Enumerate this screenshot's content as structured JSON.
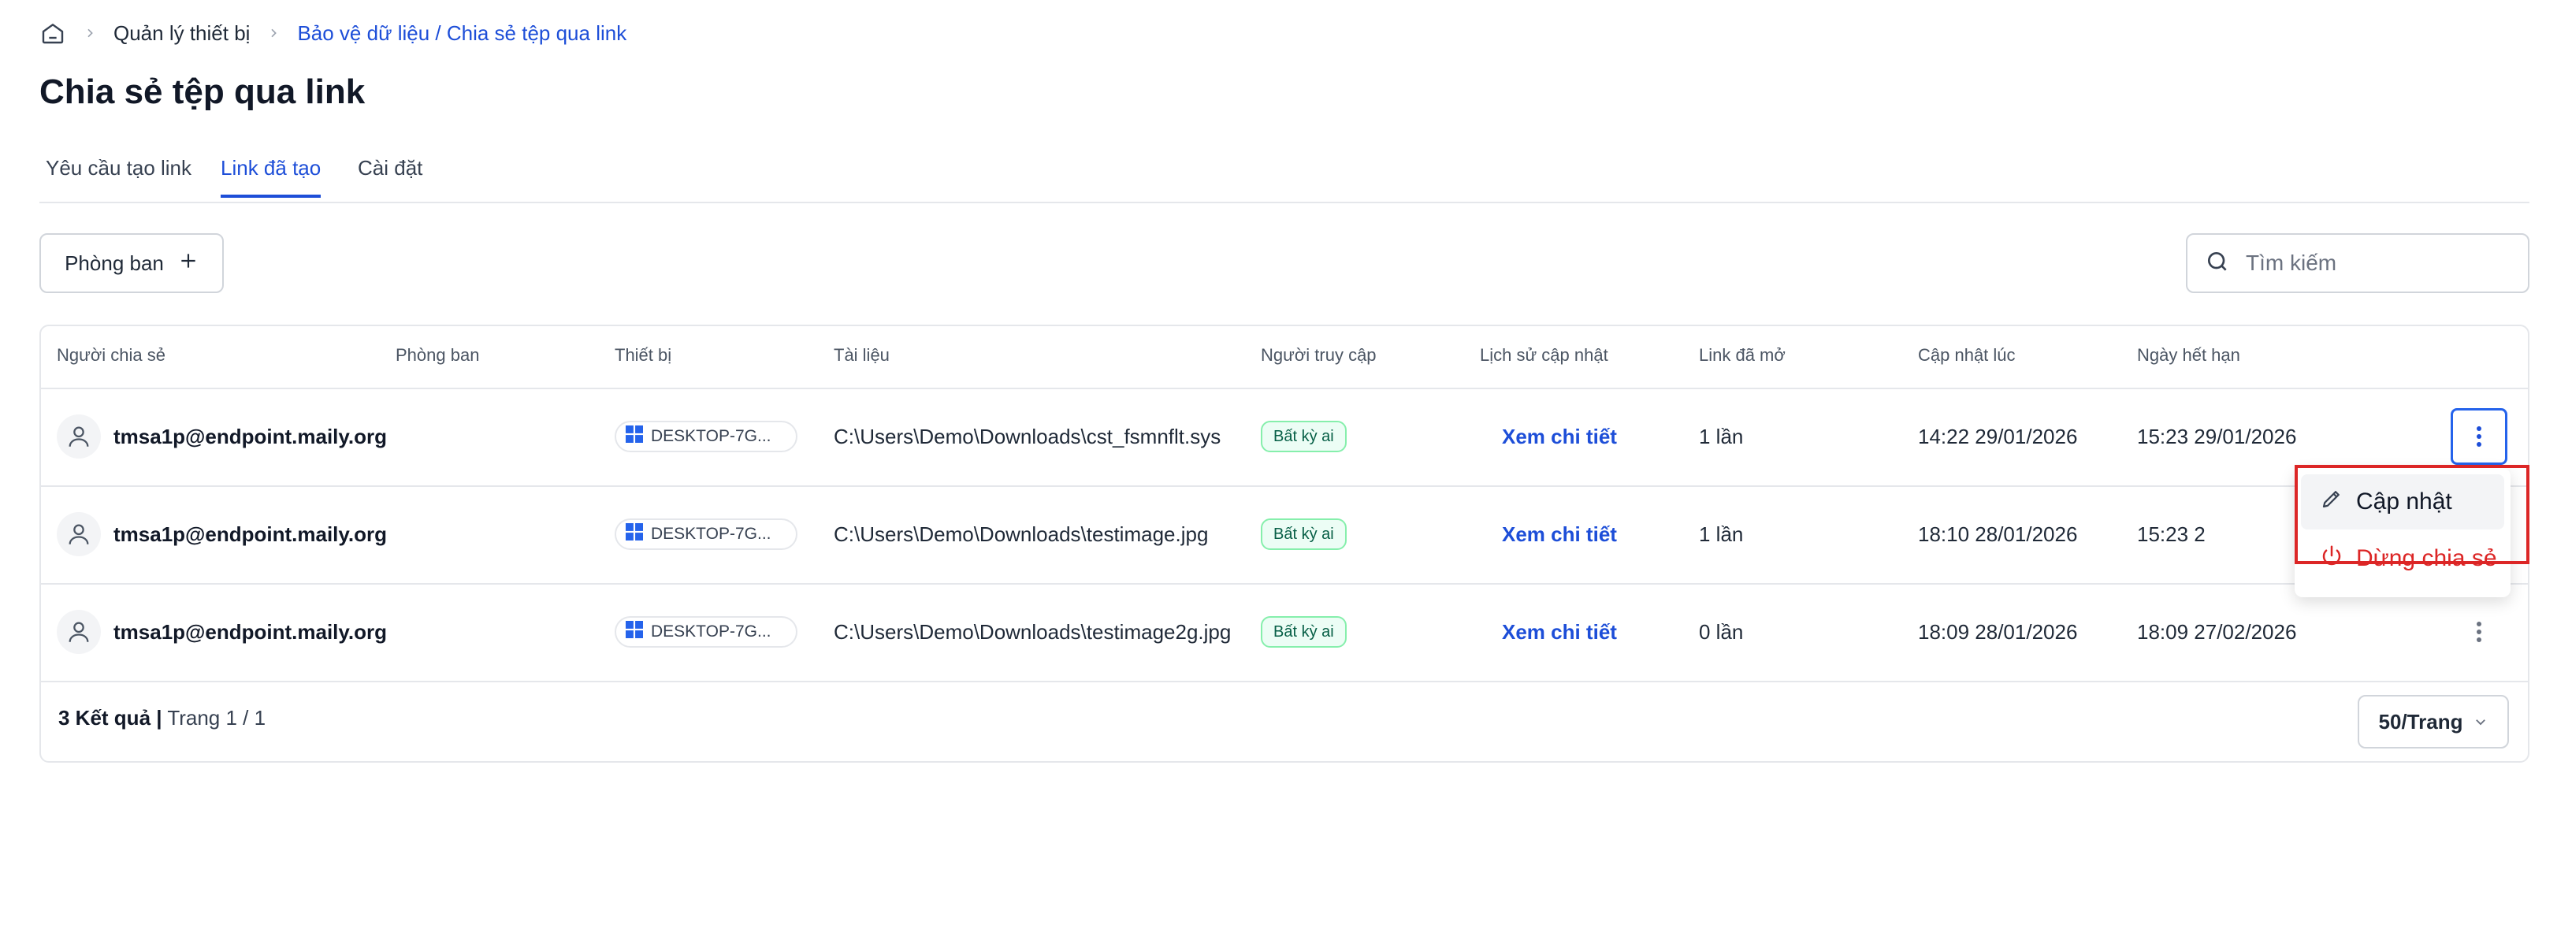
{
  "breadcrumb": {
    "item1": "Quản lý thiết bị",
    "item2": "Bảo vệ dữ liệu / Chia sẻ tệp qua link"
  },
  "page_title": "Chia sẻ tệp qua link",
  "tabs": [
    {
      "label": "Yêu cầu tạo link",
      "active": false
    },
    {
      "label": "Link đã tạo",
      "active": true
    },
    {
      "label": "Cài đặt",
      "active": false
    }
  ],
  "filter": {
    "department_label": "Phòng ban"
  },
  "search": {
    "placeholder": "Tìm kiếm"
  },
  "table": {
    "headers": [
      "Người chia sẻ",
      "Phòng ban",
      "Thiết bị",
      "Tài liệu",
      "Người truy cập",
      "Lịch sử cập nhật",
      "Link đã mở",
      "Cập nhật lúc",
      "Ngày hết hạn"
    ],
    "rows": [
      {
        "sharer": "tmsa1p@endpoint.maily.org",
        "department": "",
        "device": "DESKTOP-7G...",
        "document": "C:\\Users\\Demo\\Downloads\\cst_fsmnflt.sys",
        "access": "Bất kỳ ai",
        "history": "Xem chi tiết",
        "opened": "1 lần",
        "updated_at": "14:22 29/01/2026",
        "expires": "15:23 29/01/2026"
      },
      {
        "sharer": "tmsa1p@endpoint.maily.org",
        "department": "",
        "device": "DESKTOP-7G...",
        "document": "C:\\Users\\Demo\\Downloads\\testimage.jpg",
        "access": "Bất kỳ ai",
        "history": "Xem chi tiết",
        "opened": "1 lần",
        "updated_at": "18:10 28/01/2026",
        "expires": "15:23 2"
      },
      {
        "sharer": "tmsa1p@endpoint.maily.org",
        "department": "",
        "device": "DESKTOP-7G...",
        "document": "C:\\Users\\Demo\\Downloads\\testimage2g.jpg",
        "access": "Bất kỳ ai",
        "history": "Xem chi tiết",
        "opened": "0 lần",
        "updated_at": "18:09 28/01/2026",
        "expires": "18:09 27/02/2026"
      }
    ]
  },
  "footer": {
    "results": "3 Kết quả",
    "divider": "|",
    "page": "Trang 1 / 1",
    "page_size": "50/Trang"
  },
  "row_menu": {
    "update": "Cập nhật",
    "stop": "Dừng chia sẻ"
  },
  "colors": {
    "accent": "#1d4ed8",
    "danger": "#dc2626",
    "badge_bg": "#ecfdf5",
    "badge_border": "#86efac"
  }
}
